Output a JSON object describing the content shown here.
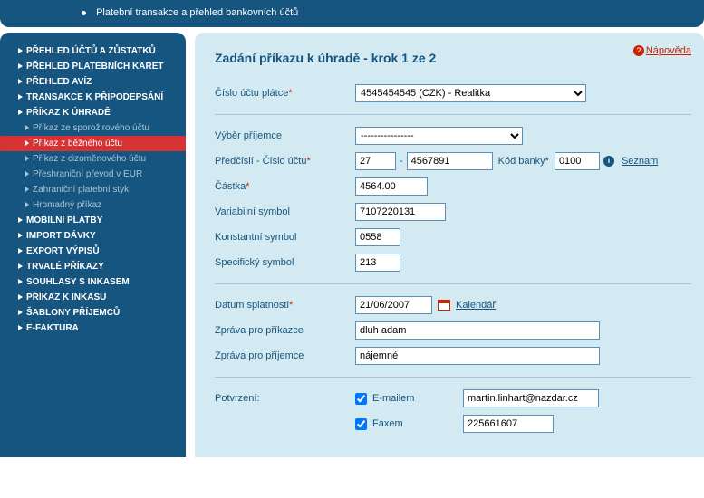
{
  "header": {
    "text": "Platební transakce a přehled bankovních účtů"
  },
  "sidebar": {
    "items": [
      {
        "type": "main",
        "label": "PŘEHLED ÚČTŮ A ZŮSTATKŮ"
      },
      {
        "type": "main",
        "label": "PŘEHLED PLATEBNÍCH KARET"
      },
      {
        "type": "main",
        "label": "PŘEHLED AVÍZ"
      },
      {
        "type": "main",
        "label": "TRANSAKCE K PŘIPODEPSÁNÍ"
      },
      {
        "type": "main",
        "label": "PŘÍKAZ K ÚHRADĚ"
      },
      {
        "type": "sub",
        "label": "Příkaz ze sporožirového účtu"
      },
      {
        "type": "sub",
        "label": "Příkaz z běžného účtu",
        "active": true
      },
      {
        "type": "sub",
        "label": "Příkaz z cizoměnového účtu"
      },
      {
        "type": "sub",
        "label": "Přeshraniční převod v EUR"
      },
      {
        "type": "sub",
        "label": "Zahraniční platební styk"
      },
      {
        "type": "sub",
        "label": "Hromadný příkaz"
      },
      {
        "type": "main",
        "label": "MOBILNÍ PLATBY"
      },
      {
        "type": "main",
        "label": "IMPORT DÁVKY"
      },
      {
        "type": "main",
        "label": "EXPORT VÝPISŮ"
      },
      {
        "type": "main",
        "label": "TRVALÉ PŘÍKAZY"
      },
      {
        "type": "main",
        "label": "SOUHLASY S INKASEM"
      },
      {
        "type": "main",
        "label": "PŘÍKAZ K INKASU"
      },
      {
        "type": "main",
        "label": "ŠABLONY PŘÍJEMCŮ"
      },
      {
        "type": "main",
        "label": "E-FAKTURA"
      }
    ]
  },
  "help": {
    "label": "Nápověda"
  },
  "title": "Zadání příkazu k úhradě - krok 1 ze 2",
  "form": {
    "payer_account": {
      "label": "Číslo účtu plátce",
      "value": "4545454545 (CZK) - Realitka"
    },
    "recipient_select": {
      "label": "Výběr příjemce",
      "value": "----------------"
    },
    "prefix_account": {
      "label": "Předčíslí - Číslo účtu",
      "prefix": "27",
      "account": "4567891"
    },
    "bank_code": {
      "label": "Kód banky",
      "value": "0100"
    },
    "seznam": "Seznam",
    "amount": {
      "label": "Částka",
      "value": "4564.00"
    },
    "var_symbol": {
      "label": "Variabilní symbol",
      "value": "7107220131"
    },
    "const_symbol": {
      "label": "Konstantní symbol",
      "value": "0558"
    },
    "spec_symbol": {
      "label": "Specifický symbol",
      "value": "213"
    },
    "due_date": {
      "label": "Datum splatnosti",
      "value": "21/06/2007"
    },
    "calendar": "Kalendář",
    "msg_payer": {
      "label": "Zpráva pro příkazce",
      "value": "dluh adam"
    },
    "msg_recipient": {
      "label": "Zpráva pro příjemce",
      "value": "nájemné"
    },
    "confirmation": {
      "label": "Potvrzení:"
    },
    "email": {
      "label": "E-mailem",
      "value": "martin.linhart@nazdar.cz",
      "checked": true
    },
    "fax": {
      "label": "Faxem",
      "value": "225661607",
      "checked": true
    }
  }
}
